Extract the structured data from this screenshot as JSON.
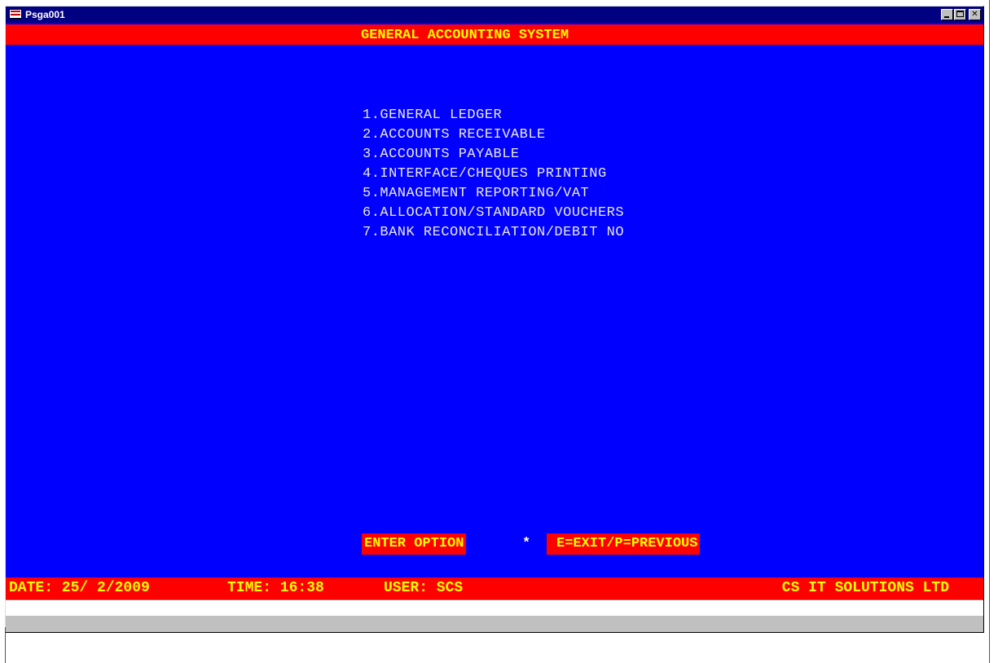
{
  "window": {
    "title": "Psga001",
    "controls": {
      "minimize_icon": "minimize-icon",
      "maximize_icon": "maximize-icon",
      "close_label": "✕"
    }
  },
  "screen": {
    "header": "GENERAL ACCOUNTING SYSTEM",
    "menu_items": [
      "1.GENERAL LEDGER",
      "2.ACCOUNTS RECEIVABLE",
      "3.ACCOUNTS PAYABLE",
      "4.INTERFACE/CHEQUES PRINTING",
      "5.MANAGEMENT REPORTING/VAT",
      "6.ALLOCATION/STANDARD VOUCHERS",
      "7.BANK RECONCILIATION/DEBIT NO"
    ],
    "prompt": {
      "label": "ENTER OPTION",
      "input_value": "*",
      "help": "E=EXIT/P=PREVIOUS"
    },
    "status": {
      "date": "DATE: 25/ 2/2009",
      "time": "TIME: 16:38",
      "user": "USER: SCS",
      "company": "CS IT SOLUTIONS LTD"
    }
  },
  "colors": {
    "console_bg": "#0000ff",
    "bar_bg": "#ff0000",
    "bar_text": "#ffff00",
    "menu_text": "#e8e8e8",
    "titlebar": "#000080"
  }
}
